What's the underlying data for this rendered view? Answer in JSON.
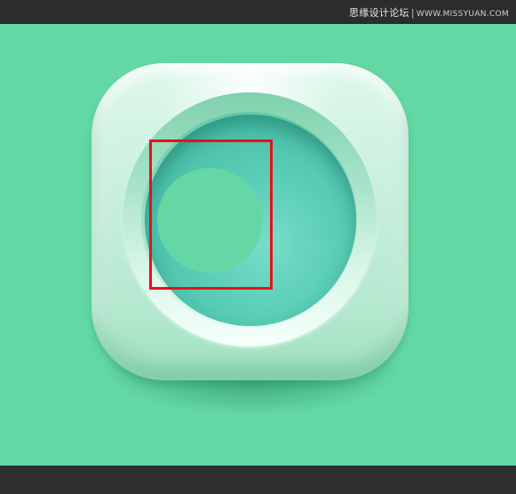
{
  "watermark": {
    "site_name": "思缘设计论坛",
    "separator": "|",
    "url": "WWW.MISSYUAN.COM"
  },
  "canvas": {
    "background_color": "#63d8a5",
    "frame_color": "#2f2f2f"
  },
  "icon": {
    "body_color": "#c9f0dd",
    "bowl_color": "#5dcfb8",
    "knob_color": "#64d7a4"
  },
  "annotation": {
    "highlight_color": "#e8101a"
  }
}
